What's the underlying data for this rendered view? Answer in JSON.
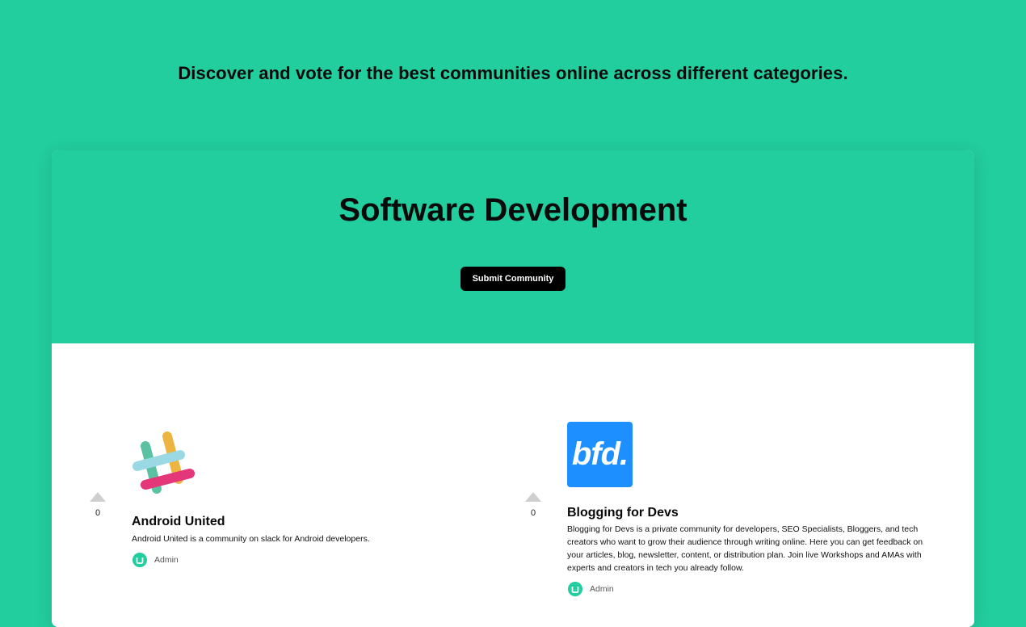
{
  "header": {
    "tagline": "Discover and vote for the best communities online across different categories."
  },
  "category": {
    "title": "Software Development",
    "submit_label": "Submit Community"
  },
  "communities": [
    {
      "name": "Android United",
      "description": "Android United is a community on slack for Android developers.",
      "votes": "0",
      "author": "Admin",
      "logo_icon": "slack-logo-icon"
    },
    {
      "name": "Blogging for Devs",
      "description": "Blogging for Devs is a private community for developers, SEO Specialists, Bloggers, and tech creators who want to grow their audience through writing online. Here you can get feedback on your articles, blog, newsletter, content, or distribution plan. Join live Workshops and AMAs with experts and creators in tech you already follow.",
      "votes": "0",
      "author": "Admin",
      "logo_text": "bfd.",
      "logo_color": "#1e8fff"
    }
  ],
  "colors": {
    "accent": "#22cd9e",
    "button": "#000000"
  }
}
